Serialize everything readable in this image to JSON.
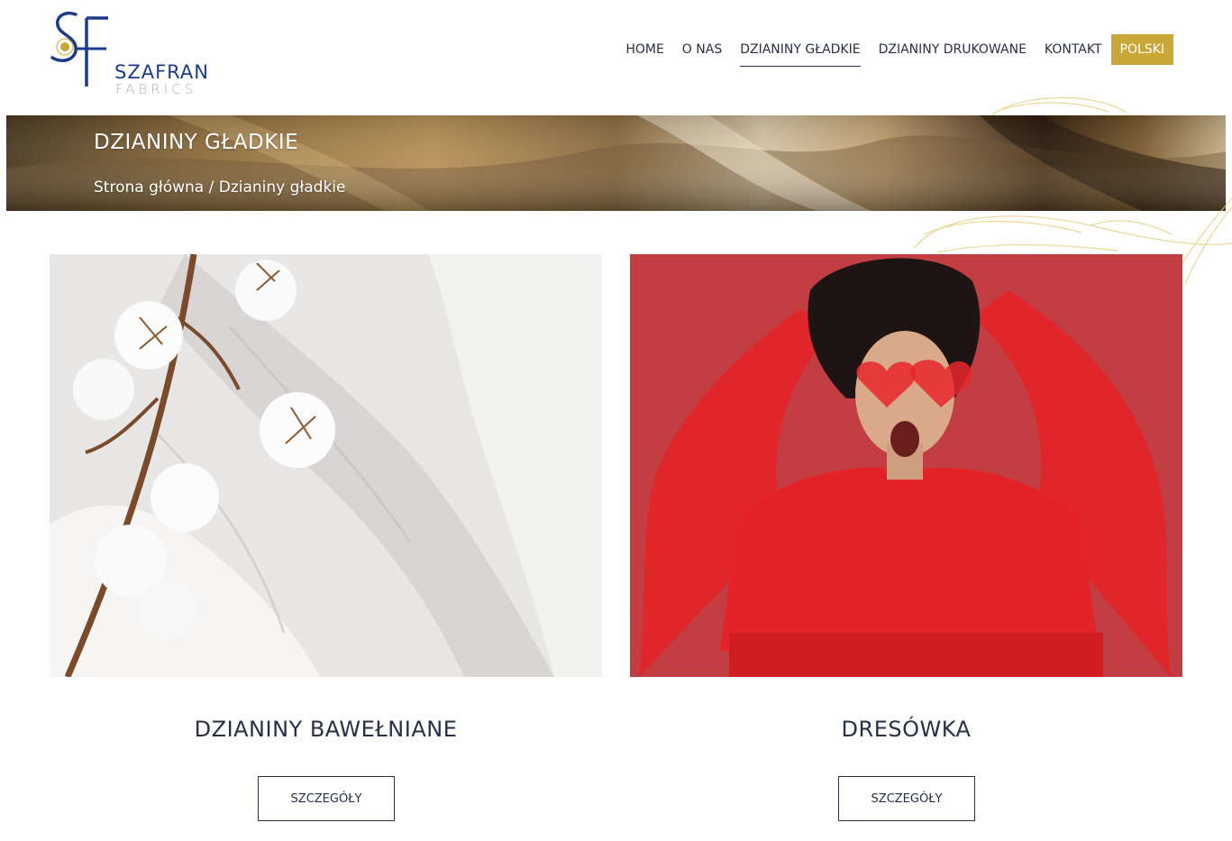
{
  "brand": {
    "name_line1": "SZAFRAN",
    "name_line2": "FABRICS",
    "primary_color": "#1d3b8a",
    "gold_color": "#c9a838"
  },
  "nav": {
    "items": [
      {
        "label": "HOME",
        "active": false
      },
      {
        "label": "O NAS",
        "active": false
      },
      {
        "label": "DZIANINY GŁADKIE",
        "active": true
      },
      {
        "label": "DZIANINY DRUKOWANE",
        "active": false
      },
      {
        "label": "KONTAKT",
        "active": false
      }
    ],
    "language": "POLSKI"
  },
  "banner": {
    "title": "DZIANINY GŁADKIE",
    "breadcrumb": "Strona główna / Dzianiny gładkie"
  },
  "products": [
    {
      "title": "DZIANINY BAWEŁNIANE",
      "button": "SZCZEGÓŁY",
      "image": "cotton-fabric-photo"
    },
    {
      "title": "DRESÓWKA",
      "button": "SZCZEGÓŁY",
      "image": "red-sweatshirt-model-photo"
    }
  ]
}
